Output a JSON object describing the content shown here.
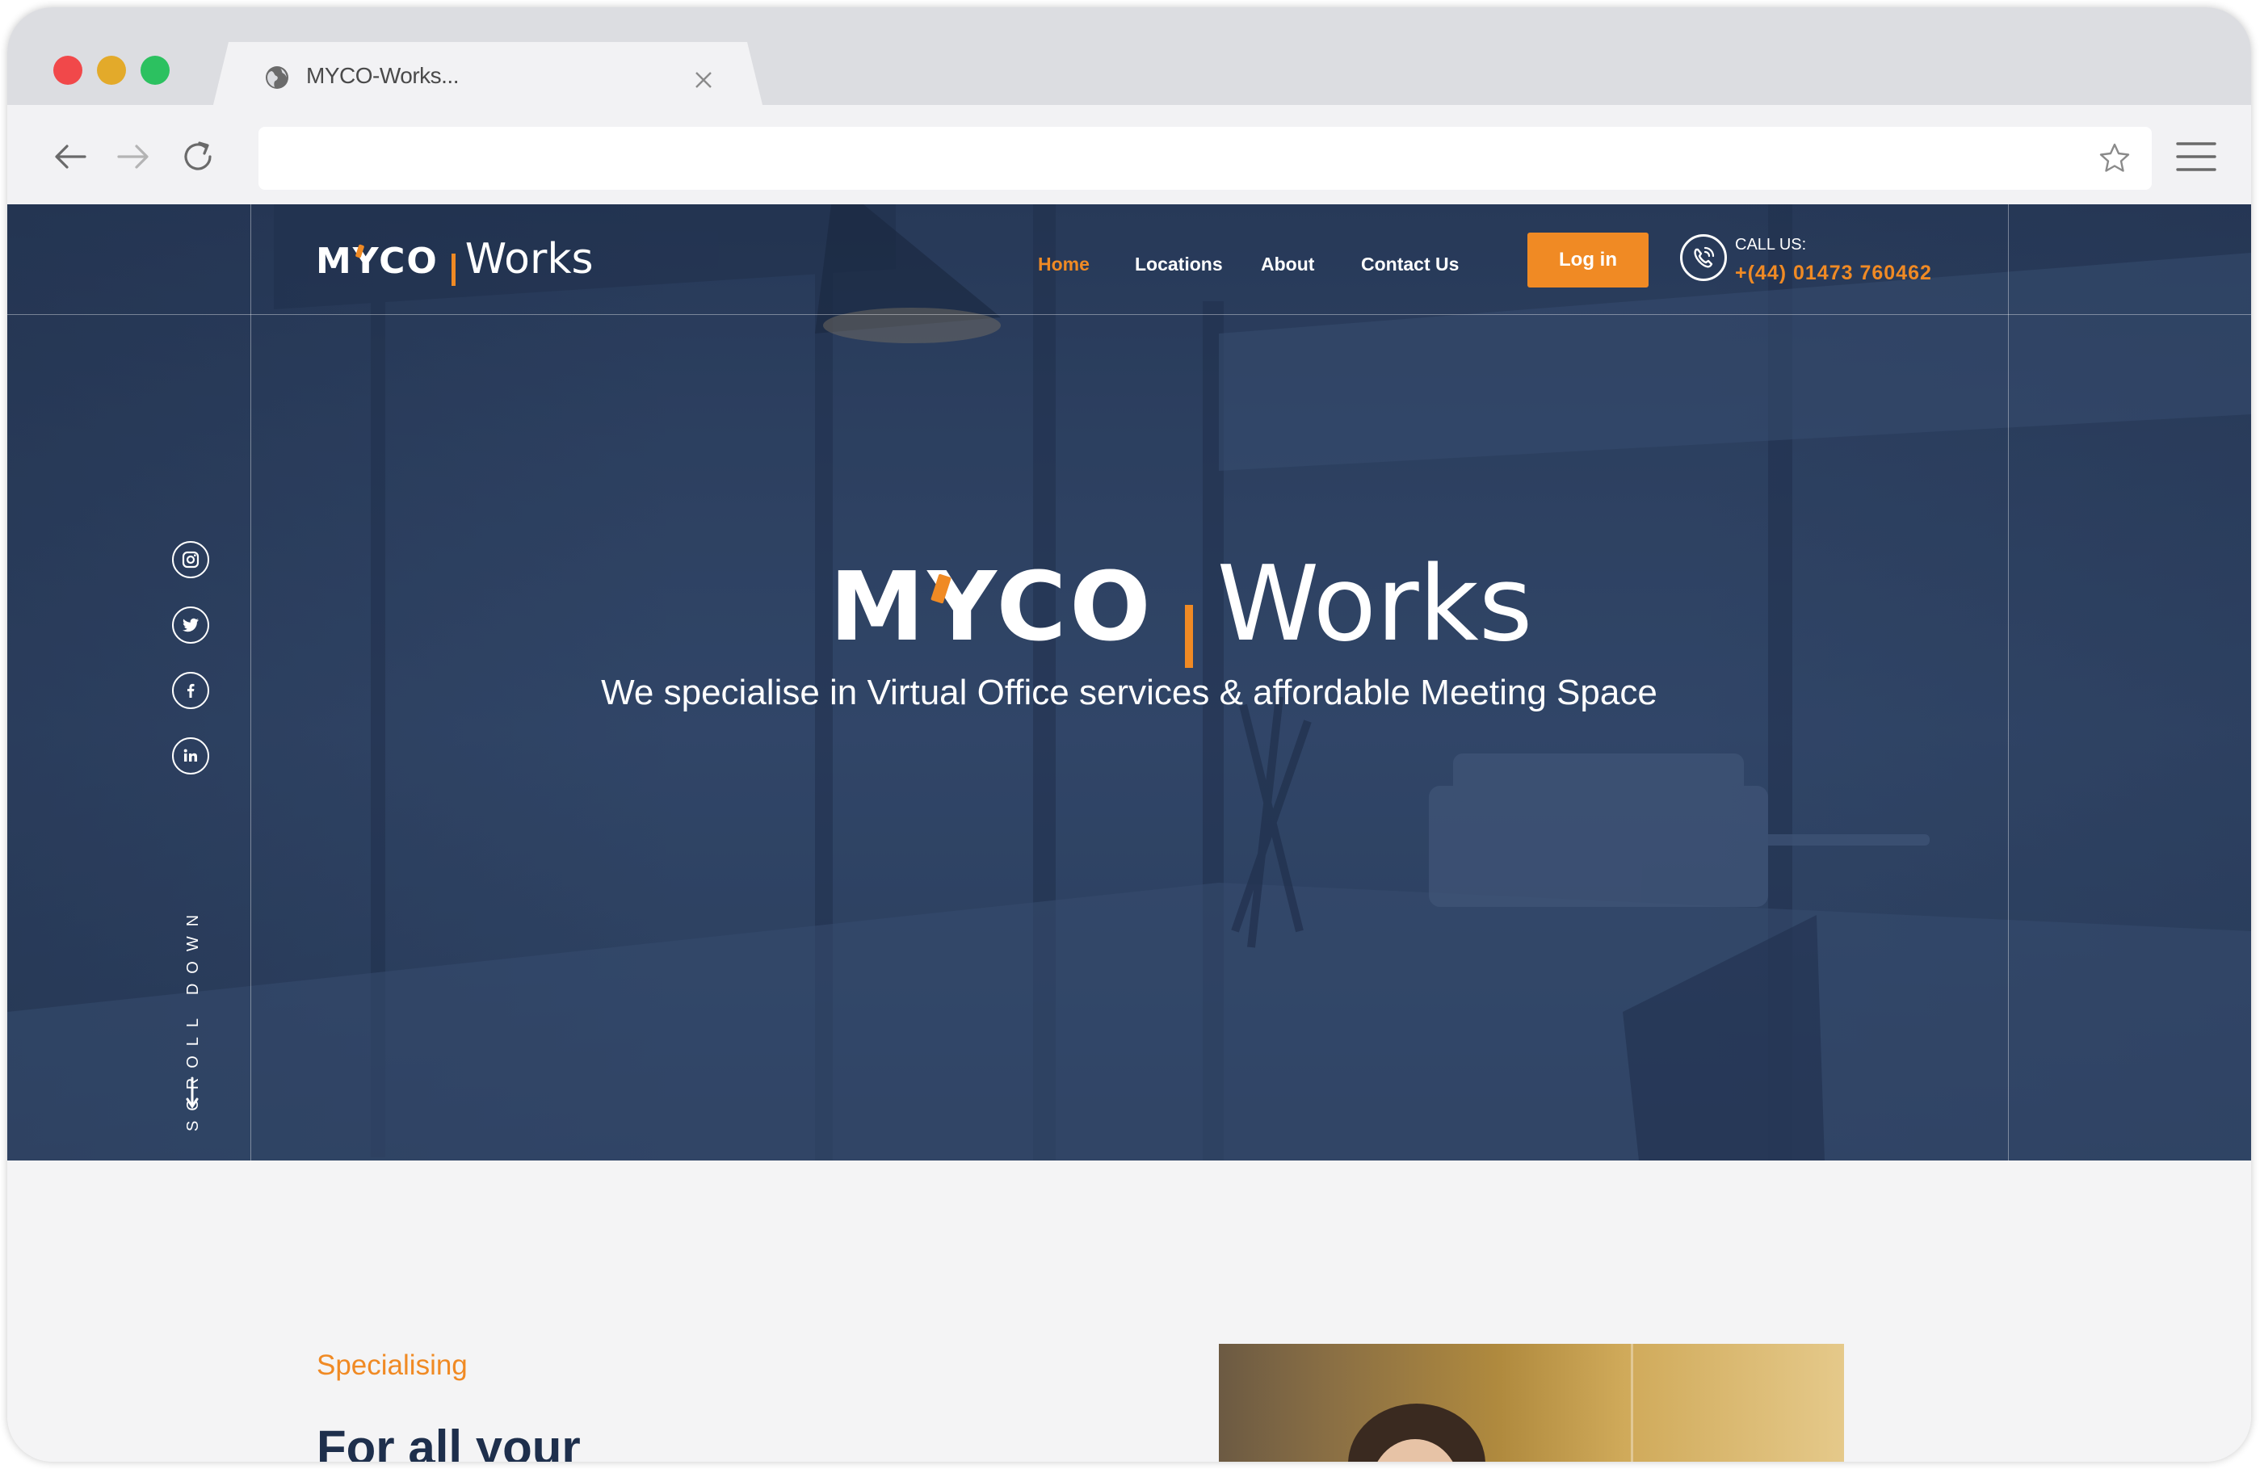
{
  "browser": {
    "tab_title": "MYCO-Works...",
    "url": "",
    "icons": [
      "globe-icon",
      "close-icon",
      "back-icon",
      "forward-icon",
      "reload-icon",
      "star-icon",
      "menu-icon"
    ]
  },
  "colors": {
    "accent": "#f08a24",
    "hero_overlay": "#2c3f5e",
    "heading": "#1e2f4c"
  },
  "header": {
    "logo_mark": "MYCO",
    "logo_word": "Works",
    "nav": [
      {
        "label": "Home",
        "active": true
      },
      {
        "label": "Locations"
      },
      {
        "label": "About"
      },
      {
        "label": "Contact Us"
      }
    ],
    "login_label": "Log in",
    "call_label": "CALL US:",
    "phone": "+(44) 01473 760462"
  },
  "hero": {
    "logo_mark": "MYCO",
    "logo_word": "Works",
    "tagline": "We specialise in Virtual Office services & affordable Meeting Space",
    "scroll_label": "SCROLL DOWN",
    "social": [
      "instagram-icon",
      "twitter-icon",
      "facebook-icon",
      "linkedin-icon"
    ]
  },
  "section": {
    "eyebrow": "Specialising",
    "heading": "For all your"
  }
}
